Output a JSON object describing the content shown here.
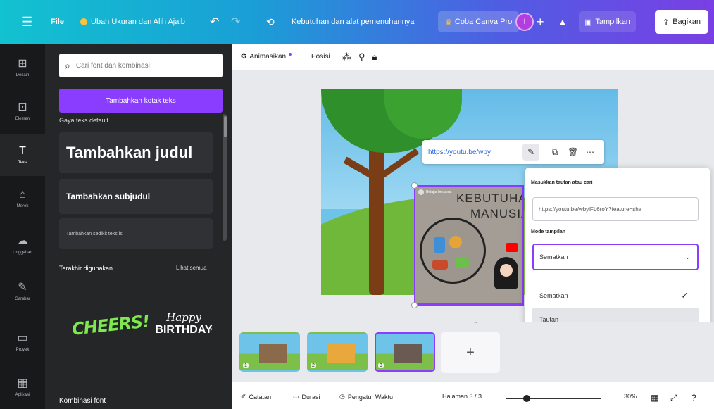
{
  "topbar": {
    "menu_icon": "hamburger-icon",
    "file_label": "File",
    "resize_label": "Ubah Ukuran dan Alih Ajaib",
    "doc_title": "Kebutuhan dan alat pemenuhannya",
    "canva_pro_label": "Coba Canva Pro",
    "avatar_initial": "I",
    "present_label": "Tampilkan",
    "share_label": "Bagikan",
    "accent_color": "#8b3dff"
  },
  "rail": {
    "items": [
      {
        "label": "Desain",
        "icon": "layout-icon"
      },
      {
        "label": "Elemen",
        "icon": "shapes-icon"
      },
      {
        "label": "Teks",
        "icon": "text-icon"
      },
      {
        "label": "Merek",
        "icon": "brand-icon"
      },
      {
        "label": "Unggahan",
        "icon": "upload-icon"
      },
      {
        "label": "Gambar",
        "icon": "draw-icon"
      },
      {
        "label": "Proyek",
        "icon": "folder-icon"
      },
      {
        "label": "Aplikasi",
        "icon": "apps-icon"
      }
    ]
  },
  "panel": {
    "search_placeholder": "Cari font dan kombinasi",
    "add_text_button": "Tambahkan kotak teks",
    "default_styles_label": "Gaya teks default",
    "heading_label": "Tambahkan judul",
    "subheading_label": "Tambahkan subjudul",
    "body_label": "Tambahkan sedikit teks isi",
    "recent_label": "Terakhir digunakan",
    "see_all_label": "Lihat semua",
    "sample1": "CHEERS!",
    "sample2_top": "Happy",
    "sample2_bottom": "BIRTHDAY",
    "combinations_label": "Kombinasi font"
  },
  "context_toolbar": {
    "animate_label": "Animasikan",
    "position_label": "Posisi"
  },
  "canvas": {
    "link_url": "https://youtu.be/wby",
    "video_title_line1": "KEBUTUHAN",
    "video_title_line2": "MANUSIA",
    "video_channel": "Belajar bersama"
  },
  "popover": {
    "link_label": "Masukkan tautan atau cari",
    "link_value": "https://youtu.be/wbylFL6roY?feature=sha",
    "mode_label": "Mode tampilan",
    "mode_selected": "Sematkan",
    "options": [
      "Sematkan",
      "Tautan"
    ]
  },
  "pages": {
    "thumbnails": [
      {
        "number": "1"
      },
      {
        "number": "2"
      },
      {
        "number": "3"
      }
    ],
    "active_index": 2,
    "add_label": "+"
  },
  "footer": {
    "notes_label": "Catatan",
    "duration_label": "Durasi",
    "timer_label": "Pengatur Waktu",
    "page_indicator": "Halaman 3 / 3",
    "zoom_value": 30,
    "zoom_label": "30%"
  }
}
